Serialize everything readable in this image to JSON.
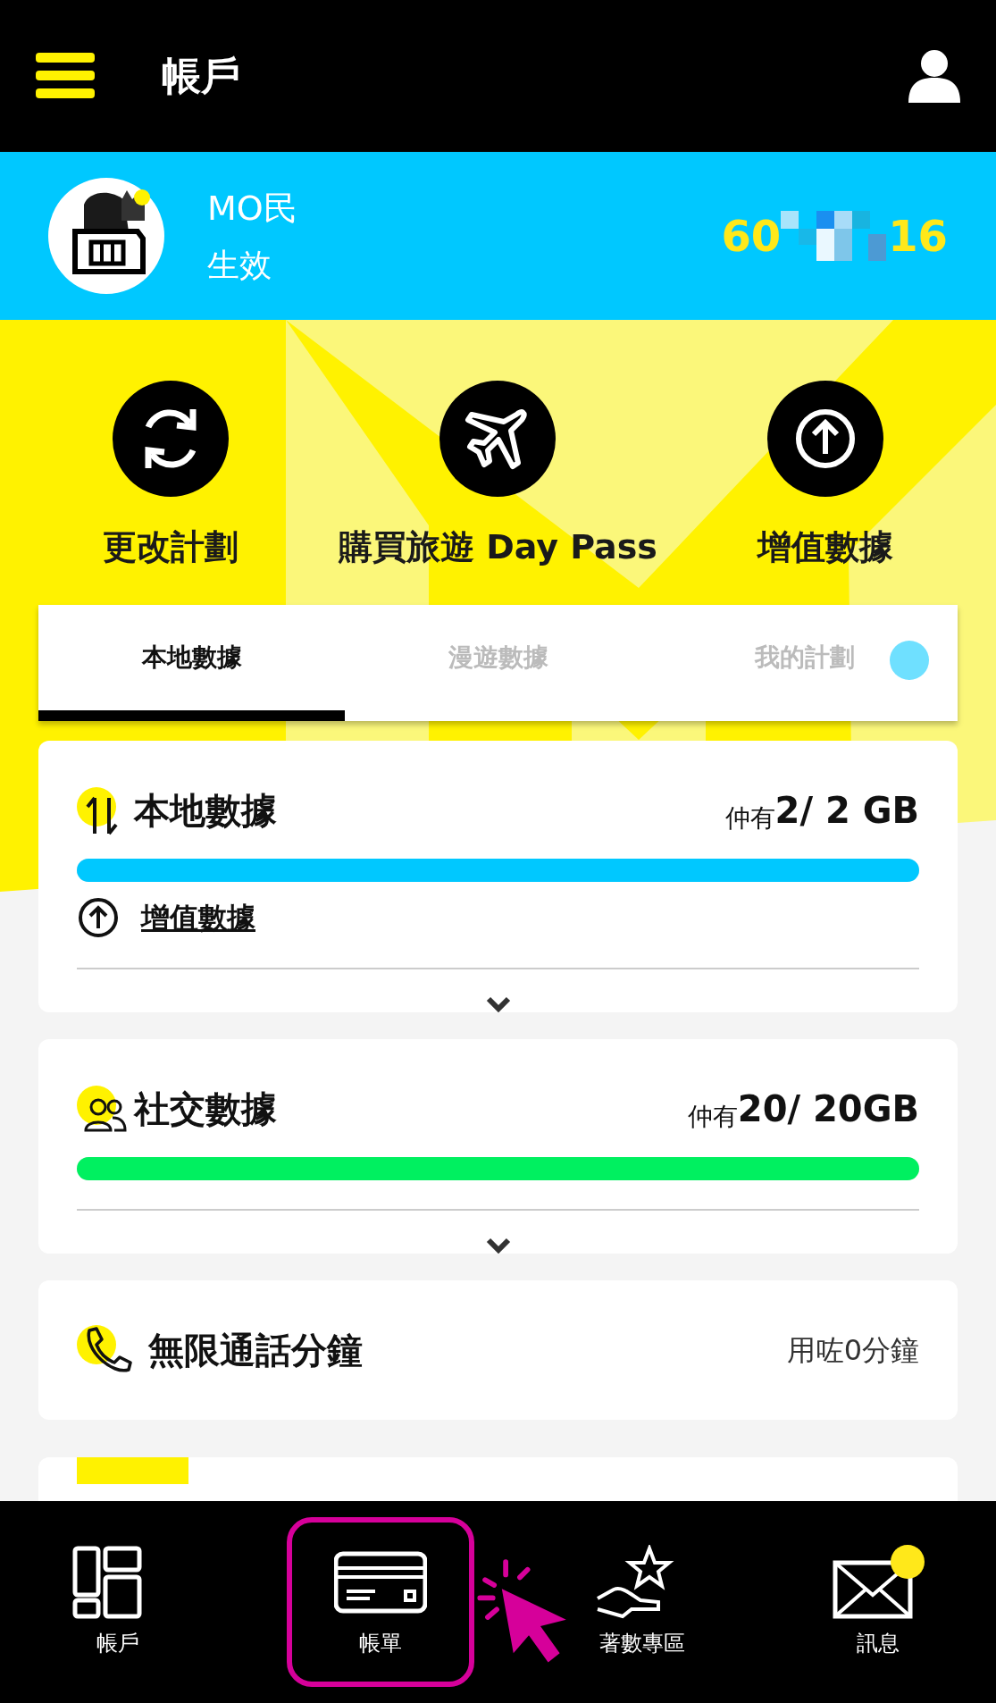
{
  "header": {
    "title": "帳戶"
  },
  "profile": {
    "name": "MO民",
    "status": "生效",
    "number_start": "60",
    "number_end": "16"
  },
  "actions": [
    {
      "label": "更改計劃"
    },
    {
      "label": "購買旅遊 Day Pass"
    },
    {
      "label": "增值數據"
    }
  ],
  "tabs": [
    {
      "label": "本地數據",
      "selected": true
    },
    {
      "label": "漫遊數據",
      "selected": false
    },
    {
      "label": "我的計劃",
      "selected": false
    }
  ],
  "data_cards": [
    {
      "title": "本地數據",
      "remaining_prefix": "仲有",
      "remaining": "2/ 2 GB",
      "level": 1,
      "color": "#00c8ff",
      "link": "增值數據"
    },
    {
      "title": "社交數據",
      "remaining_prefix": "仲有",
      "remaining": "20/ 20GB",
      "level": 1,
      "color": "#00f060"
    }
  ],
  "calls": {
    "title": "無限通話分鐘",
    "usage": "用咗0分鐘"
  },
  "nav": [
    {
      "label": "帳戶",
      "highlighted": false,
      "badge": false
    },
    {
      "label": "帳單",
      "highlighted": true,
      "badge": false
    },
    {
      "label": "著數專區",
      "highlighted": false,
      "badge": false
    },
    {
      "label": "訊息",
      "highlighted": false,
      "badge": true
    }
  ]
}
